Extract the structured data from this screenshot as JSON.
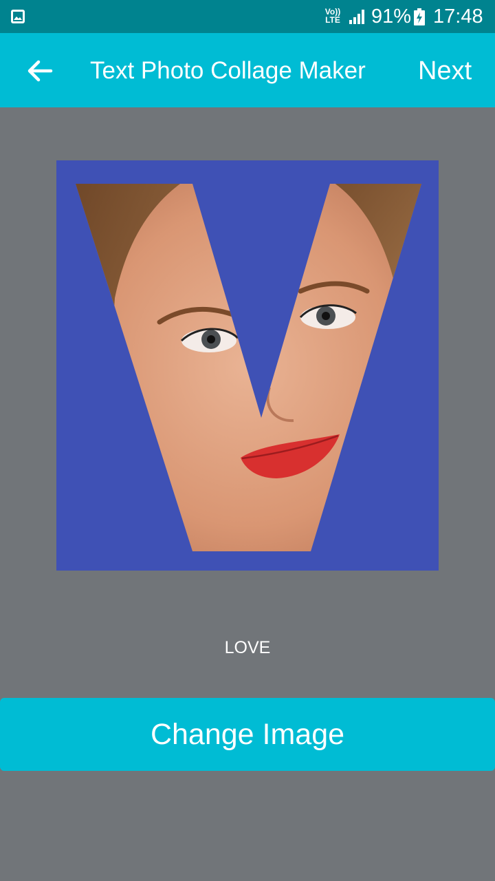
{
  "status_bar": {
    "network_label": "Vo)) LTE",
    "battery_percent": "91%",
    "time": "17:48",
    "icons": [
      "gallery-icon",
      "volte-icon",
      "signal-icon",
      "battery-charging-icon"
    ]
  },
  "app_bar": {
    "title": "Text Photo Collage Maker",
    "next_label": "Next",
    "back_icon": "arrow-back-icon"
  },
  "preview": {
    "letter": "V",
    "background_color": "#3f51b5"
  },
  "caption": "LOVE",
  "change_image_label": "Change Image",
  "colors": {
    "status_bar": "#00838f",
    "accent": "#00bcd4",
    "background": "#717579"
  }
}
